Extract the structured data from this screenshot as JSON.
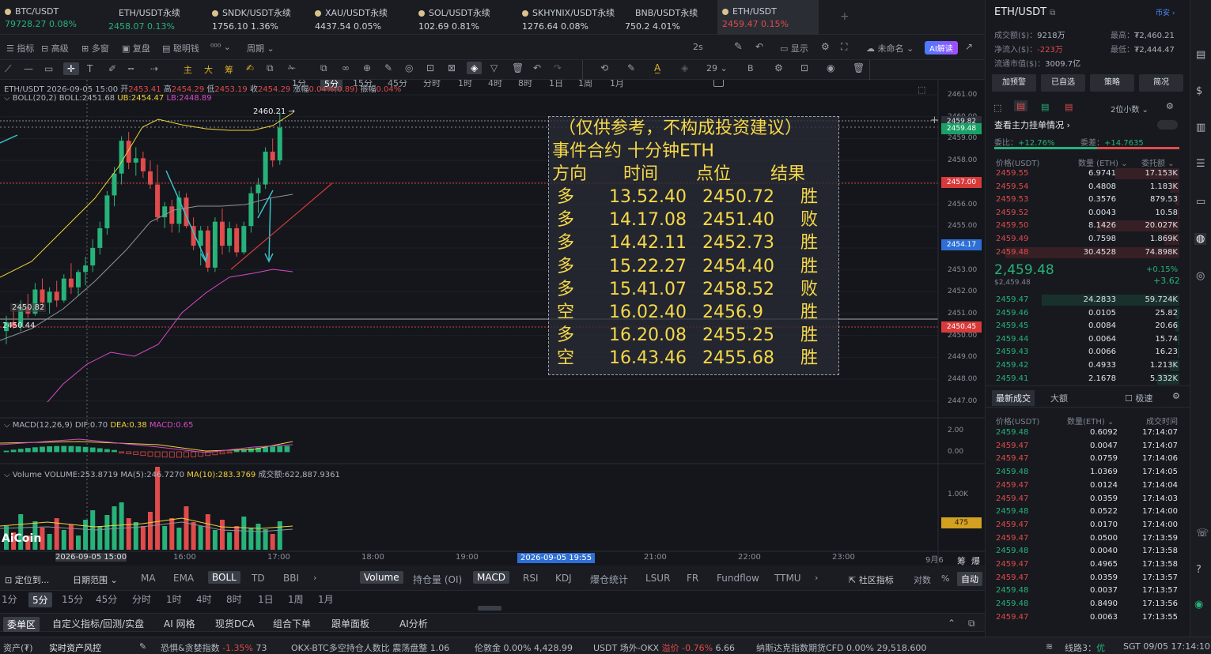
{
  "tabs": [
    {
      "name": "BTC/USDT",
      "price": "79728.27",
      "chg": "0.08%",
      "color": "up",
      "icon": "btc-icon"
    },
    {
      "name": "ETH/USDT永续",
      "price": "2458.07",
      "chg": "0.13%",
      "color": "up",
      "icon": "eth-icon"
    },
    {
      "name": "SNDK/USDT永续",
      "price": "1756.10",
      "chg": "1.36%",
      "color": "up",
      "icon": "coin-icon"
    },
    {
      "name": "XAU/USDT永续",
      "price": "4437.54",
      "chg": "0.05%",
      "color": "up",
      "icon": "gold-icon"
    },
    {
      "name": "SOL/USDT永续",
      "price": "102.69",
      "chg": "0.81%",
      "color": "up",
      "icon": "sol-icon"
    },
    {
      "name": "SKHYNIX/USDT永续",
      "price": "1276.64",
      "chg": "0.08%",
      "color": "up",
      "icon": "coin-icon"
    },
    {
      "name": "BNB/USDT永续",
      "price": "750.2",
      "chg": "4.01%",
      "color": "up",
      "icon": "bnb-icon"
    },
    {
      "name": "ETH/USDT",
      "price": "2459.47",
      "chg": "0.15%",
      "color": "down",
      "icon": "eth-icon"
    }
  ],
  "toolbar1": {
    "indicators": "指标",
    "advanced": "高级",
    "multi": "多窗",
    "replay": "复盘",
    "smart": "聪明钱",
    "period": "周期",
    "intervals": [
      "1分",
      "5分",
      "15分",
      "45分",
      "分时",
      "1时",
      "4时",
      "8时",
      "1日",
      "1周",
      "1月"
    ],
    "selected": "5分",
    "refresh": "2s",
    "display": "显示",
    "name": "未命名",
    "ai": "AI解读"
  },
  "toolbar2": {
    "count": "29",
    "bold": "B",
    "main_btn": "主",
    "big_btn": "大",
    "score_btn": "筹"
  },
  "chart_info": {
    "symbol": "ETH/USDT",
    "time": "2026-09-05 15:00",
    "open_label": "开",
    "open": "2453.41",
    "high_label": "高",
    "high": "2454.29",
    "low_label": "低",
    "low": "2453.19",
    "close_label": "收",
    "close": "2454.29",
    "chg_label": "涨幅",
    "chg": "0.04%(0.89)",
    "amp_label": "振幅",
    "amp": "0.04%"
  },
  "boll": {
    "label": "BOLL(20,2)",
    "mid": "BOLL:2451.68",
    "ub": "UB:2454.47",
    "lb": "LB:2448.89"
  },
  "macd": {
    "label": "MACD(12,26,9)",
    "dif": "DIF:0.70",
    "dea": "DEA:0.38",
    "macd": "MACD:0.65"
  },
  "volume": {
    "label": "Volume",
    "vol": "VOLUME:253.8719",
    "ma5": "MA(5):246.7270",
    "ma10": "MA(10):283.3769",
    "amount": "成交额:622,887.9361"
  },
  "price_axis": [
    "2461.00",
    "2460.00",
    "2459.00",
    "2458.00",
    "2457.00",
    "2456.00",
    "2455.00",
    "2454.00",
    "2453.00",
    "2452.00",
    "2451.00",
    "2450.00",
    "2449.00",
    "2448.00",
    "2447.00"
  ],
  "price_tags": {
    "t1": "2459.82",
    "t2": "2459.48",
    "red": "2457.00",
    "blue": "2454.17",
    "red2": "2450.45",
    "vol": "475"
  },
  "chart_labels": {
    "high_mark": "2460.21",
    "low_mark": "2450.82",
    "cross_left": "2450.44",
    "macd_axis_top": "2.00",
    "macd_axis_zero": "0.00",
    "vol_axis": "1.00K"
  },
  "time_axis": [
    "2026-09-05 15:00",
    "16:00",
    "17:00",
    "18:00",
    "19:00",
    "2026-09-05 19:55",
    "21:00",
    "22:00",
    "23:00",
    "9月6"
  ],
  "overlay": {
    "title": "（仅供参考，不构成投资建议）",
    "subtitle": "事件合约 十分钟ETH",
    "headers": [
      "方向",
      "时间",
      "点位",
      "结果"
    ],
    "rows": [
      [
        "多",
        "13.52.40",
        "2450.72",
        "胜"
      ],
      [
        "多",
        "14.17.08",
        "2451.40",
        "败"
      ],
      [
        "多",
        "14.42.11",
        "2452.73",
        "胜"
      ],
      [
        "多",
        "15.22.27",
        "2454.40",
        "胜"
      ],
      [
        "多",
        "15.41.07",
        "2458.52",
        "败"
      ],
      [
        "空",
        "16.02.40",
        "2456.9",
        "胜"
      ],
      [
        "多",
        "16.20.08",
        "2455.25",
        "胜"
      ],
      [
        "空",
        "16.43.46",
        "2455.68",
        "胜"
      ]
    ]
  },
  "bottom_tabs1": {
    "locate": "定位到...",
    "range": "日期范围",
    "indicators": [
      "MA",
      "EMA",
      "BOLL",
      "TD",
      "BBI"
    ],
    "sub": [
      "Volume",
      "持仓量 (OI)",
      "MACD",
      "RSI",
      "KDJ",
      "爆仓统计",
      "LSUR",
      "FR",
      "Fundflow",
      "TTMU"
    ],
    "community": "社区指标",
    "log": "对数",
    "pct": "%",
    "auto": "自动",
    "chip1": "筹",
    "chip2": "爆"
  },
  "bottom_tabs2": [
    "1分",
    "5分",
    "15分",
    "45分",
    "分时",
    "1时",
    "4时",
    "8时",
    "1日",
    "1周",
    "1月"
  ],
  "bottom_tabs3": [
    "委单区",
    "自定义指标/回测/实盘",
    "AI 网格",
    "现货DCA",
    "组合下单",
    "跟单面板",
    "AI分析"
  ],
  "right": {
    "symbol": "ETH/USDT",
    "exchange": "币安",
    "vol_label": "成交额($)：",
    "vol": "9218万",
    "high_label": "最高：",
    "high": "₮2,460.21",
    "net_label": "净流入($)：",
    "net": "-223万",
    "low_label": "最低：",
    "low": "₮2,444.47",
    "cap_label": "流通市值($)：",
    "cap": "3009.7亿",
    "buttons": [
      "加预警",
      "已自选",
      "策略",
      "简况"
    ],
    "decimals": "2位小数",
    "main_order": "查看主力挂单情况",
    "wb_label": "委比：",
    "wb": "+12.76%",
    "wc_label": "委差：",
    "wc": "+14.7635",
    "ob_headers": [
      "价格(USDT)",
      "数量 (ETH)",
      "委托额"
    ],
    "asks": [
      [
        "2459.55",
        "6.9741",
        "17.153K"
      ],
      [
        "2459.54",
        "0.4808",
        "1.183K"
      ],
      [
        "2459.53",
        "0.3576",
        "879.53"
      ],
      [
        "2459.52",
        "0.0043",
        "10.58"
      ],
      [
        "2459.50",
        "8.1426",
        "20.027K"
      ],
      [
        "2459.49",
        "0.7598",
        "1.869K"
      ],
      [
        "2459.48",
        "30.4528",
        "74.898K"
      ]
    ],
    "last": "2,459.48",
    "last_sub": "$2,459.48",
    "last_pct": "+0.15%",
    "last_chg": "+3.62",
    "bids": [
      [
        "2459.47",
        "24.2833",
        "59.724K"
      ],
      [
        "2459.46",
        "0.0105",
        "25.82"
      ],
      [
        "2459.45",
        "0.0084",
        "20.66"
      ],
      [
        "2459.44",
        "0.0064",
        "15.74"
      ],
      [
        "2459.43",
        "0.0066",
        "16.23"
      ],
      [
        "2459.42",
        "0.4933",
        "1.213K"
      ],
      [
        "2459.41",
        "2.1678",
        "5.332K"
      ]
    ],
    "trades_tab": "最新成交",
    "big_tab": "大额",
    "fast": "极速",
    "trade_headers": [
      "价格(USDT)",
      "数量(ETH)",
      "成交时间"
    ],
    "trades": [
      [
        "2459.48",
        "0.6092",
        "17:14:07",
        "up"
      ],
      [
        "2459.47",
        "0.0047",
        "17:14:07",
        "down"
      ],
      [
        "2459.47",
        "0.0759",
        "17:14:06",
        "down"
      ],
      [
        "2459.48",
        "1.0369",
        "17:14:05",
        "up"
      ],
      [
        "2459.47",
        "0.0124",
        "17:14:04",
        "down"
      ],
      [
        "2459.47",
        "0.0359",
        "17:14:03",
        "down"
      ],
      [
        "2459.48",
        "0.0522",
        "17:14:00",
        "up"
      ],
      [
        "2459.47",
        "0.0170",
        "17:14:00",
        "down"
      ],
      [
        "2459.47",
        "0.0500",
        "17:13:59",
        "down"
      ],
      [
        "2459.48",
        "0.0040",
        "17:13:58",
        "up"
      ],
      [
        "2459.47",
        "0.4965",
        "17:13:58",
        "down"
      ],
      [
        "2459.47",
        "0.0359",
        "17:13:57",
        "down"
      ],
      [
        "2459.48",
        "0.0037",
        "17:13:57",
        "up"
      ],
      [
        "2459.48",
        "0.8490",
        "17:13:56",
        "up"
      ],
      [
        "2459.47",
        "0.0063",
        "17:13:55",
        "down"
      ]
    ]
  },
  "status": {
    "assets": "资产(₮)",
    "risk": "实时资产风控",
    "fear": "恐惧&贪婪指数",
    "fear_chg": "-1.35%",
    "fear_val": "73",
    "okx": "OKX-BTC多空持仓人数比",
    "okx_state": "震荡盘整",
    "okx_val": "1.06",
    "gold": "伦敦金",
    "gold_chg": "0.00%",
    "gold_val": "4,428.99",
    "usdt": "USDT 场外-OKX",
    "premium": "溢价",
    "premium_val": "-0.76%",
    "usdt_val": "6.66",
    "nasdaq": "纳斯达克指数期货CFD",
    "nasdaq_chg": "0.00%",
    "nasdaq_val": "29,518.600",
    "line": "线路3：",
    "line_q": "优",
    "time": "SGT 09/05 17:14:10"
  },
  "brand": "AiCoin"
}
